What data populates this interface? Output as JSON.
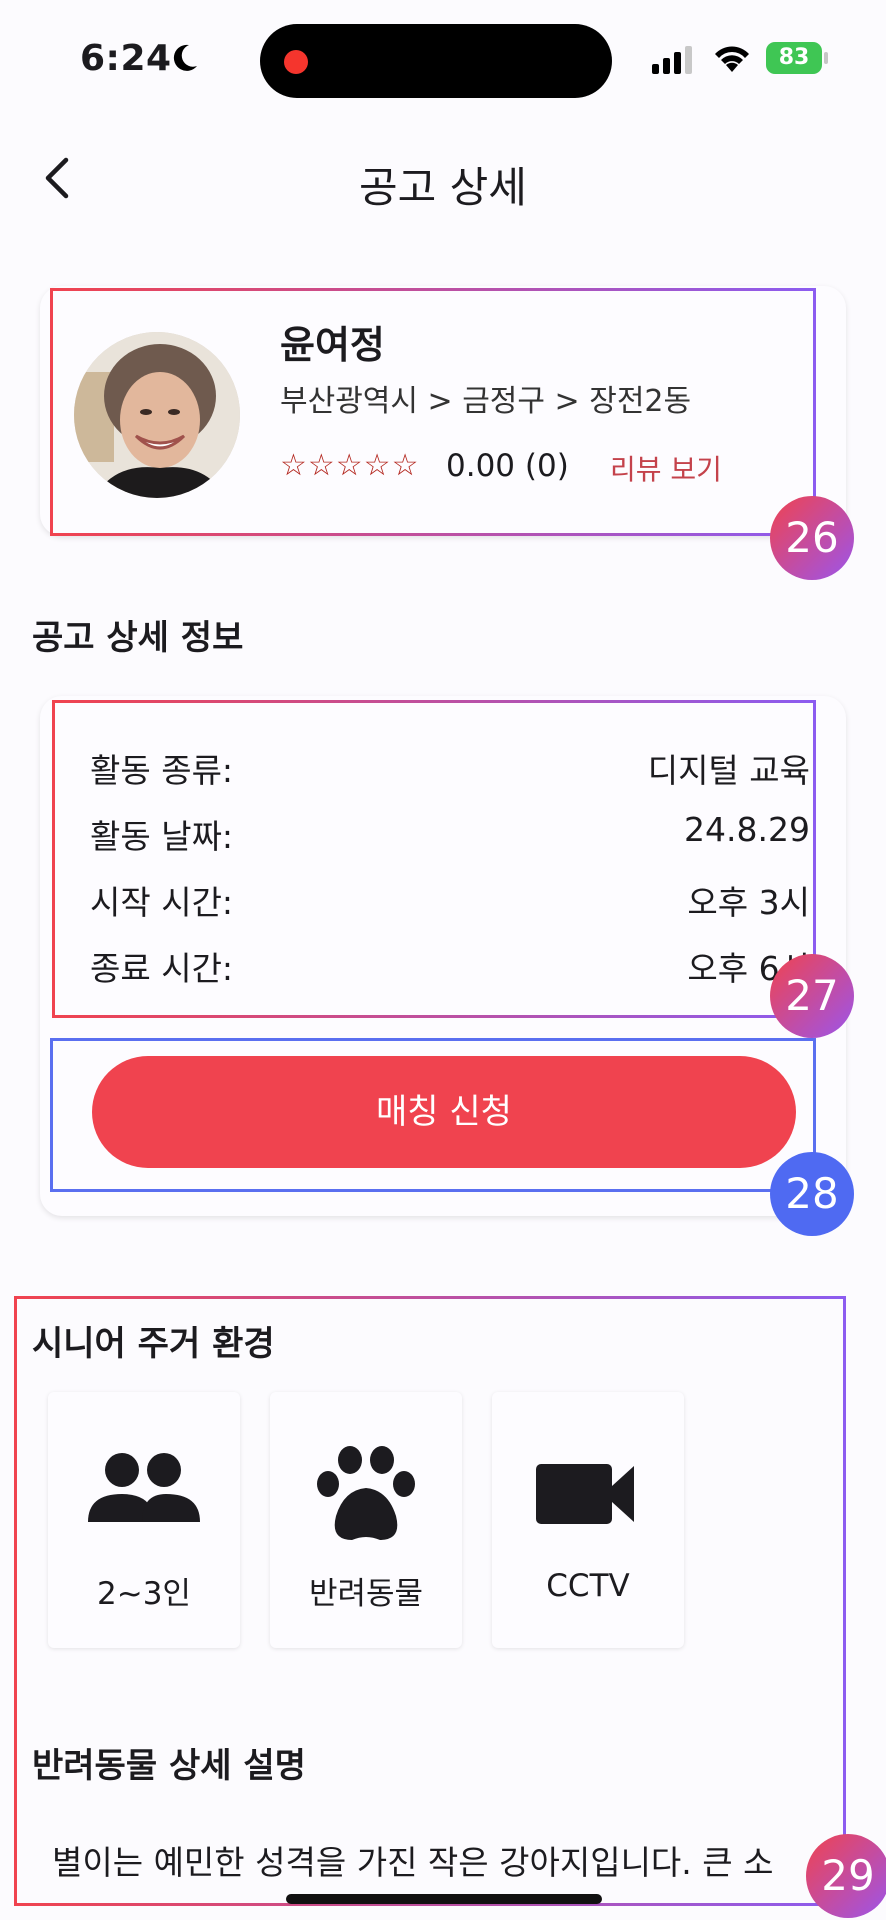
{
  "status_bar": {
    "time": "6:24",
    "battery": "83"
  },
  "header": {
    "title": "공고 상세"
  },
  "profile": {
    "name": "윤여정",
    "location": "부산광역시 > 금정구 > 장전2동",
    "stars": "☆☆☆☆☆",
    "rating": "0.00 (0)",
    "review_link": "리뷰 보기"
  },
  "details": {
    "section_title": "공고 상세 정보",
    "rows": [
      {
        "label": "활동 종류:",
        "value": "디지털 교육"
      },
      {
        "label": "활동 날짜:",
        "value": "24.8.29"
      },
      {
        "label": "시작 시간:",
        "value": "오후 3시"
      },
      {
        "label": "종료 시간:",
        "value": "오후 6시"
      }
    ],
    "match_button": "매칭 신청"
  },
  "environment": {
    "section_title": "시니어 주거 환경",
    "items": [
      {
        "icon": "people-icon",
        "label": "2~3인"
      },
      {
        "icon": "paw-icon",
        "label": "반려동물"
      },
      {
        "icon": "video-camera-icon",
        "label": "CCTV"
      }
    ]
  },
  "pet": {
    "section_title": "반려동물 상세 설명",
    "description": "별이는 예민한 성격을 가진 작은 강아지입니다. 큰 소"
  },
  "annotations": [
    "26",
    "27",
    "28",
    "29"
  ]
}
